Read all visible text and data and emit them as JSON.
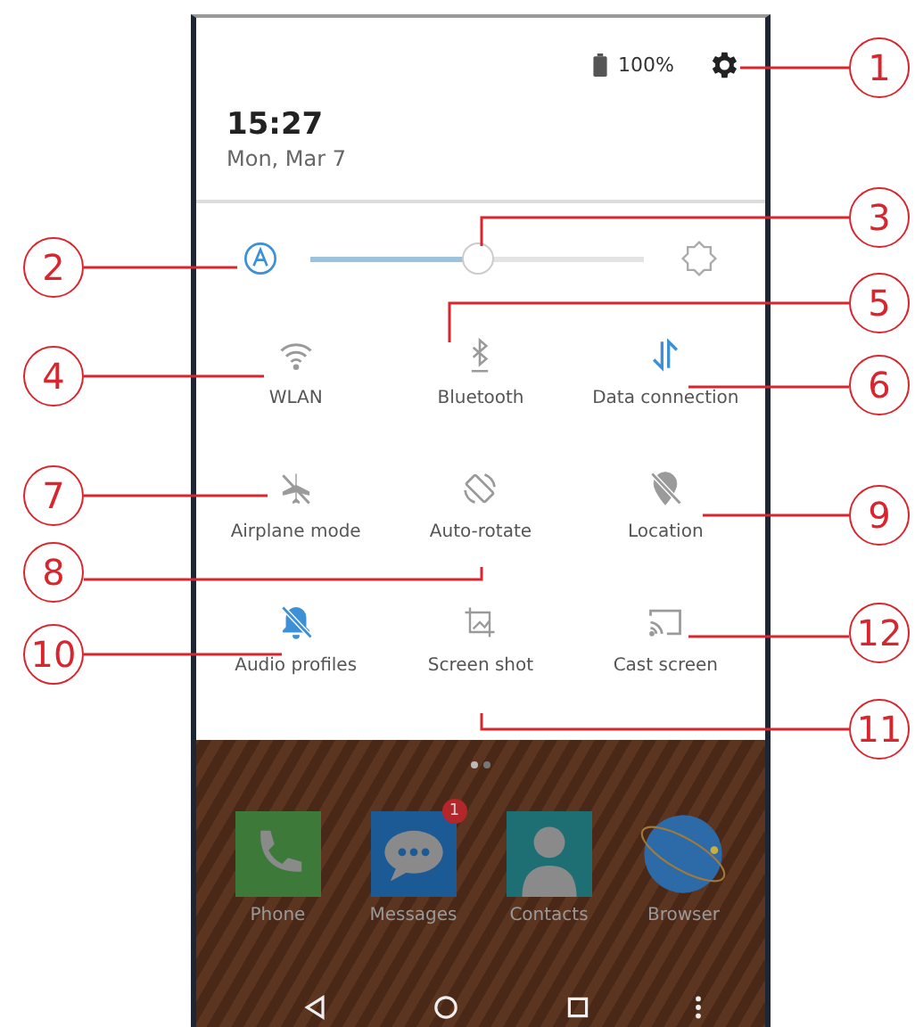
{
  "status": {
    "battery": "100%"
  },
  "header": {
    "time": "15:27",
    "date": "Mon, Mar 7"
  },
  "brightness": {
    "auto": true,
    "level": 0.5
  },
  "tiles": [
    {
      "kind": "wifi",
      "label": "WLAN",
      "on": false
    },
    {
      "kind": "bluetooth",
      "label": "Bluetooth",
      "on": false
    },
    {
      "kind": "data",
      "label": "Data connection",
      "on": true
    },
    {
      "kind": "airplane",
      "label": "Airplane mode",
      "on": false
    },
    {
      "kind": "rotate",
      "label": "Auto-rotate",
      "on": false
    },
    {
      "kind": "location",
      "label": "Location",
      "on": false
    },
    {
      "kind": "audio",
      "label": "Audio profiles",
      "on": true
    },
    {
      "kind": "screenshot",
      "label": "Screen shot",
      "on": false
    },
    {
      "kind": "cast",
      "label": "Cast screen",
      "on": false
    }
  ],
  "pages": [
    {
      "selected": true
    },
    {
      "selected": false
    }
  ],
  "dock": [
    {
      "kind": "phone",
      "label": "Phone"
    },
    {
      "kind": "messages",
      "label": "Messages",
      "badge": "1"
    },
    {
      "kind": "contacts",
      "label": "Contacts"
    },
    {
      "kind": "browser",
      "label": "Browser"
    }
  ],
  "callouts": [
    "1",
    "3",
    "2",
    "5",
    "4",
    "6",
    "7",
    "9",
    "8",
    "10",
    "12",
    "11"
  ]
}
